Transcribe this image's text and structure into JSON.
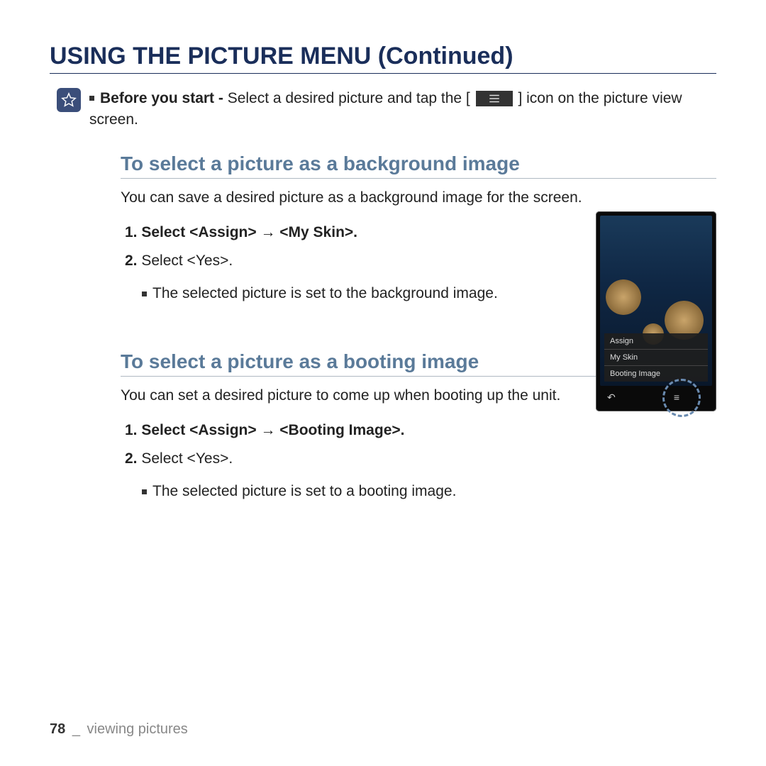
{
  "title": "USING THE PICTURE MENU (Continued)",
  "note": {
    "before_label": "Before you start - ",
    "before_text": "Select a desired picture and tap the [",
    "after_text": "] icon on the picture view screen."
  },
  "section1": {
    "heading": "To select a picture as a background image",
    "intro": "You can save a desired picture as a background image for the screen.",
    "step1_num": "1.",
    "step1_text": "Select <Assign> → <My Skin>.",
    "step2_num": "2.",
    "step2_text": "Select <Yes>.",
    "bullet": "The selected picture is set to the background image."
  },
  "device_menu": {
    "item1": "Assign",
    "item2": "My Skin",
    "item3": "Booting Image"
  },
  "section2": {
    "heading": "To select a picture as a booting image",
    "intro": "You can set a desired picture to come up when booting up the unit.",
    "step1_num": "1.",
    "step1_text": "Select <Assign> → <Booting Image>.",
    "step2_num": "2.",
    "step2_text": "Select <Yes>.",
    "bullet": "The selected picture is set to a booting image."
  },
  "footer": {
    "page": "78",
    "separator": "_",
    "chapter": "viewing pictures"
  }
}
